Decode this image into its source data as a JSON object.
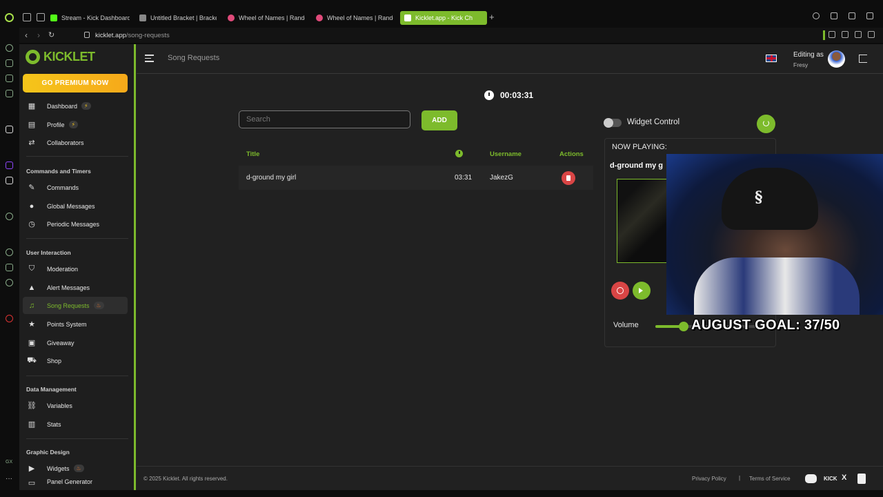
{
  "browser": {
    "tabs": [
      {
        "label": "Stream - Kick Dashboard",
        "color": "#53fc18"
      },
      {
        "label": "Untitled Bracket | Bracket",
        "color": "#888888"
      },
      {
        "label": "Wheel of Names | Random",
        "color": "#e04a7a"
      },
      {
        "label": "Wheel of Names | Random",
        "color": "#e04a7a"
      },
      {
        "label": "Kicklet.app - Kick Ch",
        "color": "#ffffff"
      }
    ],
    "url_host": "kicklet.app",
    "url_path": "/song-requests"
  },
  "app": {
    "logo_text": "KICKLET",
    "premium_label": "GO PREMIUM NOW",
    "nav": {
      "dashboard": "Dashboard",
      "profile": "Profile",
      "collaborators": "Collaborators",
      "section_commands": "Commands and Timers",
      "commands": "Commands",
      "global_messages": "Global Messages",
      "periodic_messages": "Periodic Messages",
      "section_user": "User Interaction",
      "moderation": "Moderation",
      "alert_messages": "Alert Messages",
      "song_requests": "Song Requests",
      "points_system": "Points System",
      "giveaway": "Giveaway",
      "shop": "Shop",
      "section_data": "Data Management",
      "variables": "Variables",
      "stats": "Stats",
      "section_graphic": "Graphic Design",
      "widgets": "Widgets",
      "panel_generator": "Panel Generator"
    },
    "topbar": {
      "page_title": "Song Requests",
      "editing_as": "Editing as",
      "user": "Fresy"
    },
    "timer": "00:03:31",
    "search_placeholder": "Search",
    "add_label": "ADD",
    "table": {
      "headers": {
        "title": "Title",
        "username": "Username",
        "actions": "Actions"
      },
      "rows": [
        {
          "title": "d-ground my girl",
          "duration": "03:31",
          "username": "JakezG"
        }
      ]
    },
    "widget_control_label": "Widget Control",
    "now_playing": {
      "label": "NOW PLAYING:",
      "song": "d-ground my g",
      "volume_label": "Volume",
      "volume": 0.27
    },
    "overlay_goal": "AUGUST GOAL: 37/50",
    "footer": {
      "copyright": "© 2025 Kicklet. All rights reserved.",
      "privacy": "Privacy Policy",
      "sep": "|",
      "terms": "Terms of Service",
      "kick": "KICK",
      "x": "X"
    }
  }
}
